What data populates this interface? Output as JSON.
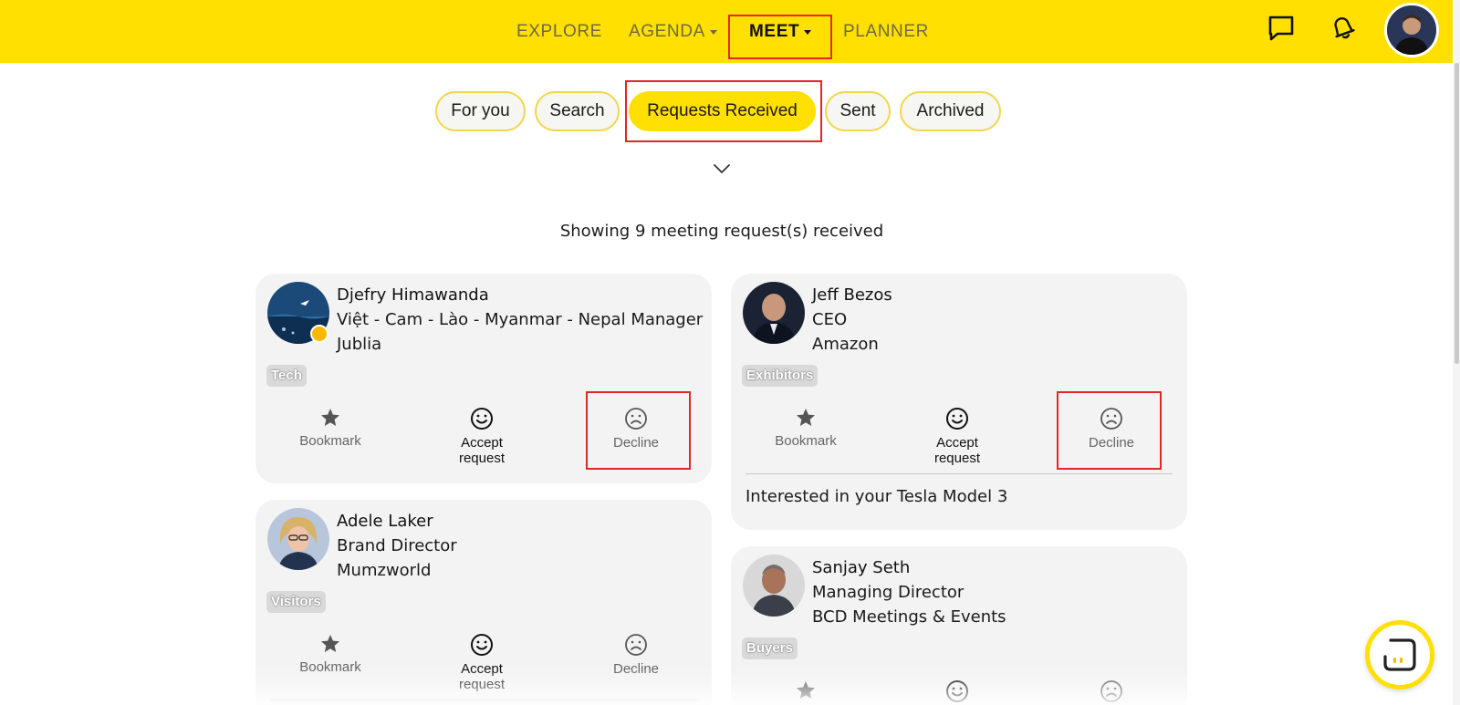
{
  "nav": {
    "items": [
      {
        "label": "EXPLORE",
        "has_caret": false,
        "active": false
      },
      {
        "label": "AGENDA",
        "has_caret": true,
        "active": false
      },
      {
        "label": "MEET",
        "has_caret": true,
        "active": true
      },
      {
        "label": "PLANNER",
        "has_caret": false,
        "active": false
      }
    ],
    "icons": [
      "chat-icon",
      "bell-icon",
      "user-avatar"
    ]
  },
  "tabs": [
    {
      "label": "For you",
      "active": false
    },
    {
      "label": "Search",
      "active": false
    },
    {
      "label": "Requests Received",
      "active": true
    },
    {
      "label": "Sent",
      "active": false
    },
    {
      "label": "Archived",
      "active": false
    }
  ],
  "summary": "Showing 9 meeting request(s) received",
  "actions": {
    "bookmark": "Bookmark",
    "accept_line1": "Accept",
    "accept_line2": "request",
    "decline": "Decline"
  },
  "requests": [
    {
      "name": "Djefry Himawanda",
      "title": "Việt - Cam - Lào - Myanmar - Nepal Manager",
      "company": "Jublia",
      "tag": "Tech",
      "online": true,
      "message": ""
    },
    {
      "name": "Jeff Bezos",
      "title": "CEO",
      "company": "Amazon",
      "tag": "Exhibitors",
      "online": false,
      "message": "Interested in your Tesla Model 3"
    },
    {
      "name": "Adele Laker",
      "title": "Brand Director",
      "company": "Mumzworld",
      "tag": "Visitors",
      "online": false,
      "message": ""
    },
    {
      "name": "Sanjay Seth",
      "title": "Managing Director",
      "company": "BCD Meetings & Events",
      "tag": "Buyers",
      "online": false,
      "message": ""
    }
  ],
  "colors": {
    "brand_yellow": "#ffe000",
    "highlight_red": "#e32626",
    "card_bg": "#f3f3f4",
    "online_dot": "#f7b900"
  }
}
